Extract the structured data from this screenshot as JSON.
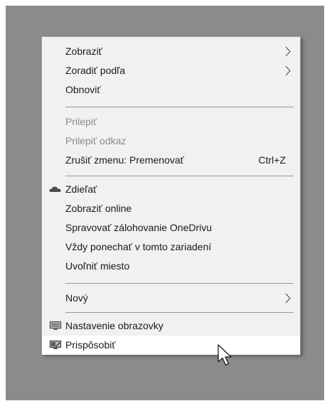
{
  "context_menu": {
    "items": [
      {
        "label": "Zobraziť",
        "has_submenu": true
      },
      {
        "label": "Zoradiť podľa",
        "has_submenu": true
      },
      {
        "label": "Obnoviť"
      },
      {
        "label": "Prilepiť",
        "disabled": true
      },
      {
        "label": "Prilepiť odkaz",
        "disabled": true
      },
      {
        "label": "Zrušiť zmenu: Premenovať",
        "shortcut": "Ctrl+Z"
      },
      {
        "label": "Zdieľať",
        "icon": "cloud-icon"
      },
      {
        "label": "Zobraziť online"
      },
      {
        "label": "Spravovať zálohovanie OneDrivu"
      },
      {
        "label": "Vždy ponechať v tomto zariadení"
      },
      {
        "label": "Uvoľniť miesto"
      },
      {
        "label": "Nový",
        "has_submenu": true
      },
      {
        "label": "Nastavenie obrazovky",
        "icon": "display-icon"
      },
      {
        "label": "Prispôsobiť",
        "icon": "personalize-icon",
        "hovered": true
      }
    ]
  },
  "colors": {
    "desktop": "#8b8b8b",
    "menu_background": "#f1f1f1",
    "hover_background": "#ffffff",
    "disabled_text": "#8a8a8a"
  }
}
